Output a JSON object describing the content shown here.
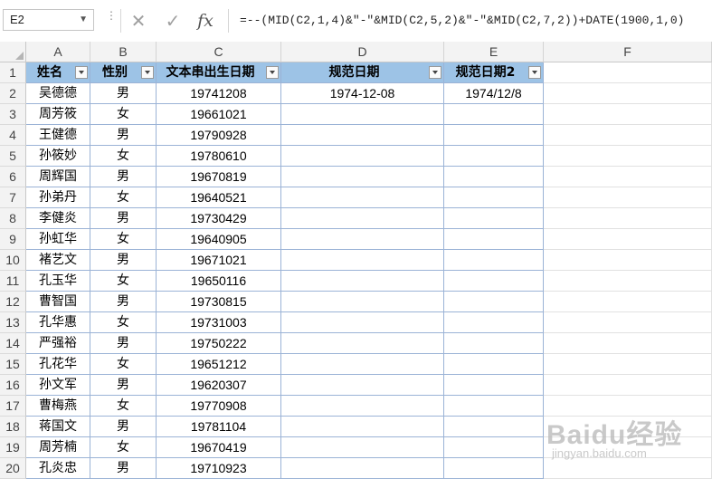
{
  "formula_bar": {
    "name_box": "E2",
    "cancel_glyph": "✕",
    "enter_glyph": "✓",
    "fx_label": "fx",
    "formula": "=--(MID(C2,1,4)&\"-\"&MID(C2,5,2)&\"-\"&MID(C2,7,2))+DATE(1900,1,0)"
  },
  "columns": [
    "A",
    "B",
    "C",
    "D",
    "E",
    "F"
  ],
  "header_row": [
    "姓名",
    "性别",
    "文本串出生日期",
    "规范日期",
    "规范日期2"
  ],
  "rows": [
    [
      "吴德德",
      "男",
      "19741208",
      "1974-12-08",
      "1974/12/8"
    ],
    [
      "周芳筱",
      "女",
      "19661021",
      "",
      ""
    ],
    [
      "王健德",
      "男",
      "19790928",
      "",
      ""
    ],
    [
      "孙筱妙",
      "女",
      "19780610",
      "",
      ""
    ],
    [
      "周辉国",
      "男",
      "19670819",
      "",
      ""
    ],
    [
      "孙弟丹",
      "女",
      "19640521",
      "",
      ""
    ],
    [
      "李健炎",
      "男",
      "19730429",
      "",
      ""
    ],
    [
      "孙虹华",
      "女",
      "19640905",
      "",
      ""
    ],
    [
      "褚艺文",
      "男",
      "19671021",
      "",
      ""
    ],
    [
      "孔玉华",
      "女",
      "19650116",
      "",
      ""
    ],
    [
      "曹智国",
      "男",
      "19730815",
      "",
      ""
    ],
    [
      "孔华惠",
      "女",
      "19731003",
      "",
      ""
    ],
    [
      "严强裕",
      "男",
      "19750222",
      "",
      ""
    ],
    [
      "孔花华",
      "女",
      "19651212",
      "",
      ""
    ],
    [
      "孙文军",
      "男",
      "19620307",
      "",
      ""
    ],
    [
      "曹梅燕",
      "女",
      "19770908",
      "",
      ""
    ],
    [
      "蒋国文",
      "男",
      "19781104",
      "",
      ""
    ],
    [
      "周芳楠",
      "女",
      "19670419",
      "",
      ""
    ],
    [
      "孔炎忠",
      "男",
      "19710923",
      "",
      ""
    ]
  ],
  "row_numbers": [
    "1",
    "2",
    "3",
    "4",
    "5",
    "6",
    "7",
    "8",
    "9",
    "10",
    "11",
    "12",
    "13",
    "14",
    "15",
    "16",
    "17",
    "18",
    "19",
    "20"
  ],
  "watermark": {
    "logo": "Baidu经验",
    "url": "jingyan.baidu.com"
  },
  "colors": {
    "table_header": "#9dc3e6",
    "table_border": "#9bb3d6",
    "grid_header_bg": "#f3f3f3"
  }
}
